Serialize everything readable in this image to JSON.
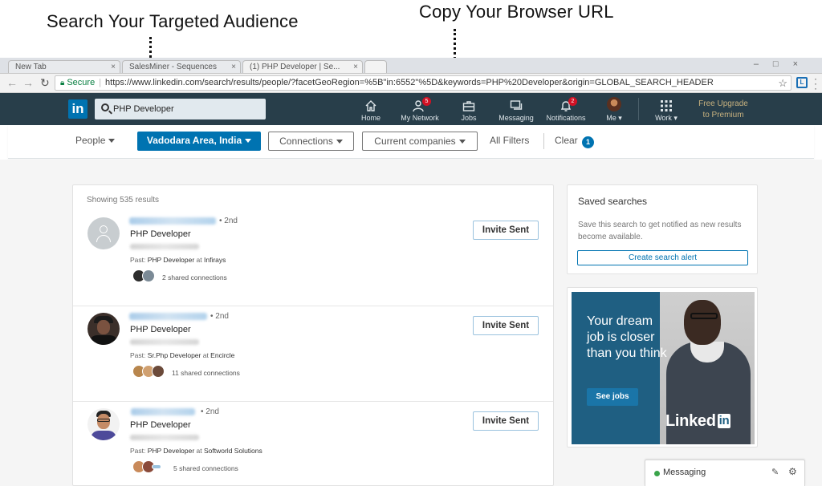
{
  "annotations": {
    "left": "Search Your Targeted Audience",
    "right": "Copy Your Browser URL"
  },
  "browser": {
    "tabs": [
      "New Tab",
      "SalesMiner - Sequences",
      "(1) PHP Developer | Se..."
    ],
    "secure_label": "Secure",
    "url": "https://www.linkedin.com/search/results/people/?facetGeoRegion=%5B\"in:6552\"%5D&keywords=PHP%20Developer&origin=GLOBAL_SEARCH_HEADER"
  },
  "linkedin_nav": {
    "logo": "in",
    "search_value": "PHP Developer",
    "items": [
      {
        "label": "Home",
        "icon": "home-icon"
      },
      {
        "label": "My Network",
        "icon": "network-icon",
        "badge": "5"
      },
      {
        "label": "Jobs",
        "icon": "briefcase-icon"
      },
      {
        "label": "Messaging",
        "icon": "chat-icon"
      },
      {
        "label": "Notifications",
        "icon": "bell-icon",
        "badge": "2"
      },
      {
        "label": "Me ▾",
        "icon": "avatar"
      },
      {
        "label": "Work ▾",
        "icon": "grid-icon"
      }
    ],
    "premium": [
      "Free Upgrade",
      "to Premium"
    ]
  },
  "filters": {
    "people": "People",
    "location": "Vadodara Area, India",
    "connections": "Connections",
    "companies": "Current companies",
    "all_filters": "All Filters",
    "clear": "Clear",
    "count": "1"
  },
  "results": {
    "count_text": "Showing 535 results",
    "items": [
      {
        "degree": "• 2nd",
        "title": "PHP Developer",
        "past_prefix": "Past: ",
        "past_role": "PHP Developer",
        "past_mid": " at ",
        "past_company": "Infirays",
        "shared": "2 shared connections",
        "action": "Invite Sent"
      },
      {
        "degree": "• 2nd",
        "title": "PHP Developer",
        "past_prefix": "Past: ",
        "past_role": "Sr.Php Developer",
        "past_mid": " at ",
        "past_company": "Encircle",
        "shared": "11 shared connections",
        "action": "Invite Sent"
      },
      {
        "degree": "• 2nd",
        "title": "PHP Developer",
        "past_prefix": "Past: ",
        "past_role": "PHP Developer",
        "past_mid": " at ",
        "past_company": "Softworld Solutions",
        "shared": "5 shared connections",
        "action": "Invite Sent"
      }
    ]
  },
  "saved_searches": {
    "title": "Saved searches",
    "text": "Save this search to get notified as new results become available.",
    "button": "Create search alert"
  },
  "ad": {
    "headline": "Your dream job is closer than you think",
    "button": "See jobs",
    "logo_text": "Linked",
    "logo_in": "in"
  },
  "messaging": {
    "label": "Messaging"
  },
  "colors": {
    "nav_bg": "#283e4a",
    "brand_blue": "#0073b1",
    "premium_gold": "#c7b17f",
    "badge_red": "#d11124",
    "secure_green": "#0b8043"
  }
}
